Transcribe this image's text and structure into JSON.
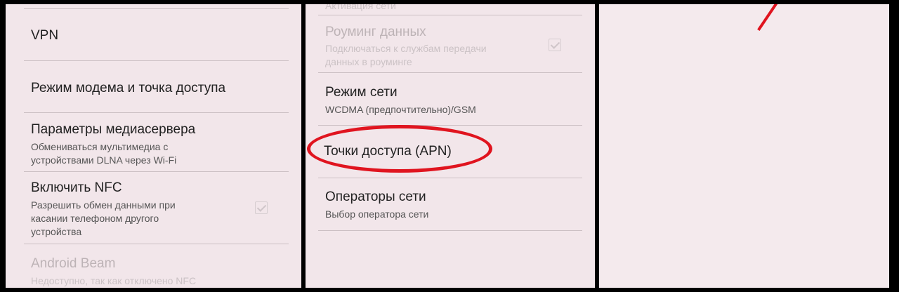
{
  "left_panel": {
    "vpn": {
      "title": "VPN"
    },
    "tethering": {
      "title": "Режим модема и точка доступа"
    },
    "media_server": {
      "title": "Параметры медиасервера",
      "subtitle_line1": "Обмениваться мультимедиа с",
      "subtitle_line2": "устройствами DLNA через Wi-Fi"
    },
    "nfc": {
      "title": "Включить NFC",
      "subtitle_line1": "Разрешить обмен данными при",
      "subtitle_line2": "касании телефоном другого",
      "subtitle_line3": "устройства",
      "checked": true
    },
    "android_beam": {
      "title": "Android Beam",
      "subtitle_line1": "Недоступно, так как отключено NFC"
    }
  },
  "middle_panel": {
    "top_partial": {
      "text": "Активация сети"
    },
    "data_roaming": {
      "title": "Роуминг данных",
      "subtitle_line1": "Подключаться к службам передачи",
      "subtitle_line2": "данных в роуминге",
      "checked": true
    },
    "network_mode": {
      "title": "Режим сети",
      "subtitle": "WCDMA (предпочтительно)/GSM"
    },
    "apn": {
      "title": "Точки доступа (APN)"
    },
    "operators": {
      "title": "Операторы сети",
      "subtitle": "Выбор оператора сети"
    }
  },
  "colors": {
    "highlight": "#e0141f",
    "panel_bg": "#f2e6ea",
    "frame": "#000000"
  }
}
